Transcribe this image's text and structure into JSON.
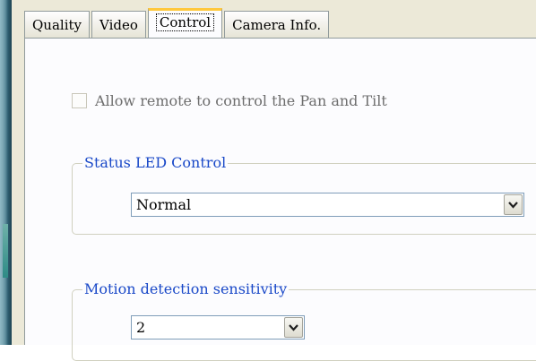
{
  "tabs": [
    {
      "label": "Quality"
    },
    {
      "label": "Video"
    },
    {
      "label": "Control"
    },
    {
      "label": "Camera Info."
    }
  ],
  "active_tab": "Control",
  "remote_control": {
    "label": "Allow remote to control the Pan and Tilt",
    "checked": false,
    "enabled": false
  },
  "status_led": {
    "legend": "Status LED Control",
    "selected": "Normal"
  },
  "motion_detection": {
    "legend": "Motion detection sensitivity",
    "selected": "2"
  },
  "colors": {
    "legend_text": "#1a49c8",
    "active_tab_highlight": "#ffc83c",
    "dialog_background": "#ece9d8"
  },
  "icons": {
    "dropdown_arrow": "chevron-down-icon"
  }
}
